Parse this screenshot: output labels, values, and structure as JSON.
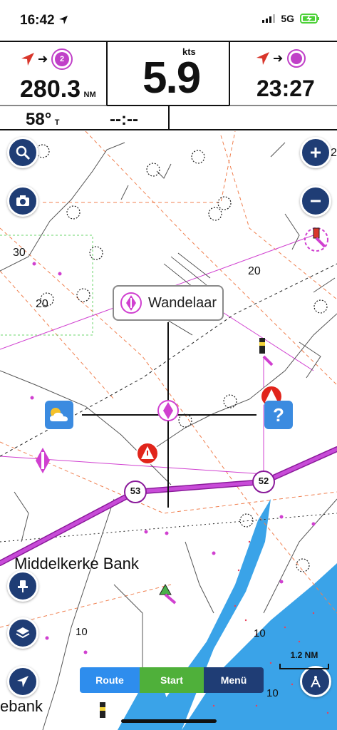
{
  "status_bar": {
    "time": "16:42",
    "network": "5G"
  },
  "panel": {
    "distance_value": "280.3",
    "distance_unit": "NM",
    "waypoint_badge": "2",
    "speed_unit": "kts",
    "speed_value": "5.9",
    "eta": "23:27",
    "heading_value": "58°",
    "heading_unit": "T",
    "time_placeholder": "--:--"
  },
  "map": {
    "depth_labels": [
      "30",
      "20",
      "20",
      "10",
      "10",
      "10",
      "2"
    ],
    "route_points": [
      "53",
      "52"
    ],
    "place_name": "Middelkerke Bank",
    "place_name_2": "ebank",
    "selected_label": "Wandelaar",
    "scale_value": "1.2",
    "scale_unit": "NM"
  },
  "toolbar": {
    "route_label": "Route",
    "start_label": "Start",
    "menu_label": "Menü"
  },
  "colors": {
    "accent_blue": "#1f3d75",
    "magenta": "#c040c8",
    "shallow_blue": "#3aa3e8",
    "start_green": "#4fb03a",
    "route_blue": "#2e8ded"
  }
}
